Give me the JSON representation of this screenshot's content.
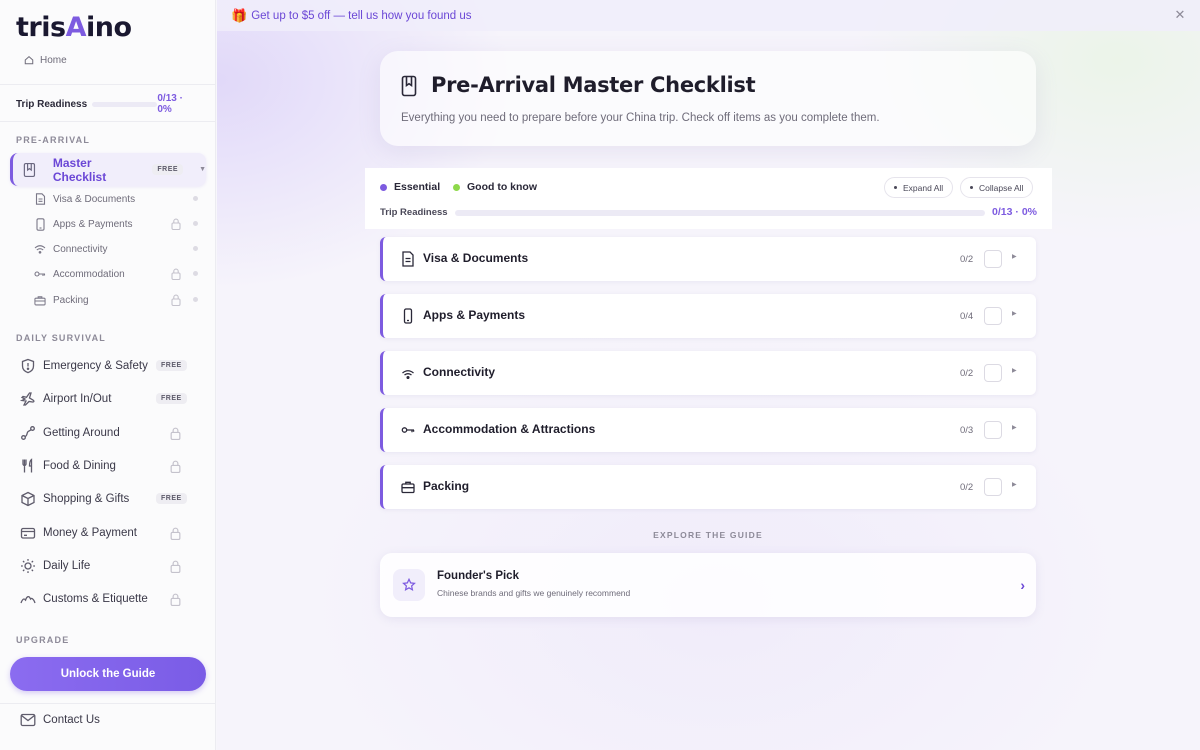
{
  "brand": {
    "logo_prefix": "tris",
    "logo_accent": "A",
    "logo_suffix": "ino",
    "accent_color": "#7d5be0",
    "essential_color": "#7d5be0",
    "good_to_know_color": "#8ed94a"
  },
  "sidebar": {
    "home_label": "Home",
    "readiness_label": "Trip Readiness",
    "readiness_value": "0/13 · 0%",
    "readiness_progress": 0,
    "section_pre_arrival": "PRE-ARRIVAL",
    "master": {
      "label": "Master Checklist",
      "badge": "FREE",
      "icon": "bookmark-icon",
      "expanded": true
    },
    "sub_items": [
      {
        "label": "Visa & Documents",
        "icon": "document-icon",
        "locked": false
      },
      {
        "label": "Apps & Payments",
        "icon": "phone-icon",
        "locked": true
      },
      {
        "label": "Connectivity",
        "icon": "wifi-icon",
        "locked": false
      },
      {
        "label": "Accommodation",
        "icon": "key-icon",
        "locked": true
      },
      {
        "label": "Packing",
        "icon": "briefcase-icon",
        "locked": true
      }
    ],
    "section_daily": "DAILY SURVIVAL",
    "daily_items": [
      {
        "label": "Emergency & Safety",
        "icon": "shield-icon",
        "badge": "FREE"
      },
      {
        "label": "Airport In/Out",
        "icon": "plane-icon",
        "badge": "FREE"
      },
      {
        "label": "Getting Around",
        "icon": "route-icon",
        "locked": true
      },
      {
        "label": "Food & Dining",
        "icon": "fork-knife-icon",
        "locked": true
      },
      {
        "label": "Shopping & Gifts",
        "icon": "box-icon",
        "badge": "FREE"
      },
      {
        "label": "Money & Payment",
        "icon": "credit-card-icon",
        "locked": true
      },
      {
        "label": "Daily Life",
        "icon": "sun-icon",
        "locked": true
      },
      {
        "label": "Customs & Etiquette",
        "icon": "mountain-icon",
        "locked": true
      }
    ],
    "section_upgrade": "UPGRADE",
    "unlock_label": "Unlock the Guide",
    "contact_label": "Contact Us"
  },
  "promo": {
    "icon": "gift-icon",
    "text": "Get up to $5 off — tell us how you found us",
    "close_icon": "close-icon"
  },
  "header": {
    "title": "Pre-Arrival Master Checklist",
    "subtitle": "Everything you need to prepare before your China trip. Check off items as you complete them."
  },
  "filters": {
    "legend_essential": "Essential",
    "legend_good": "Good to know",
    "expand_all": "Expand All",
    "collapse_all": "Collapse All",
    "readiness_label": "Trip Readiness",
    "readiness_value": "0/13 · 0%",
    "readiness_progress": 0
  },
  "categories": [
    {
      "name": "Visa & Documents",
      "count": "0/2",
      "icon": "document-icon"
    },
    {
      "name": "Apps & Payments",
      "count": "0/4",
      "icon": "phone-icon"
    },
    {
      "name": "Connectivity",
      "count": "0/2",
      "icon": "wifi-icon"
    },
    {
      "name": "Accommodation & Attractions",
      "count": "0/3",
      "icon": "key-icon"
    },
    {
      "name": "Packing",
      "count": "0/2",
      "icon": "briefcase-icon"
    }
  ],
  "explore": {
    "label": "EXPLORE THE GUIDE",
    "card_title": "Founder's Pick",
    "card_subtitle": "Chinese brands and gifts we genuinely recommend",
    "card_icon": "star-icon"
  }
}
